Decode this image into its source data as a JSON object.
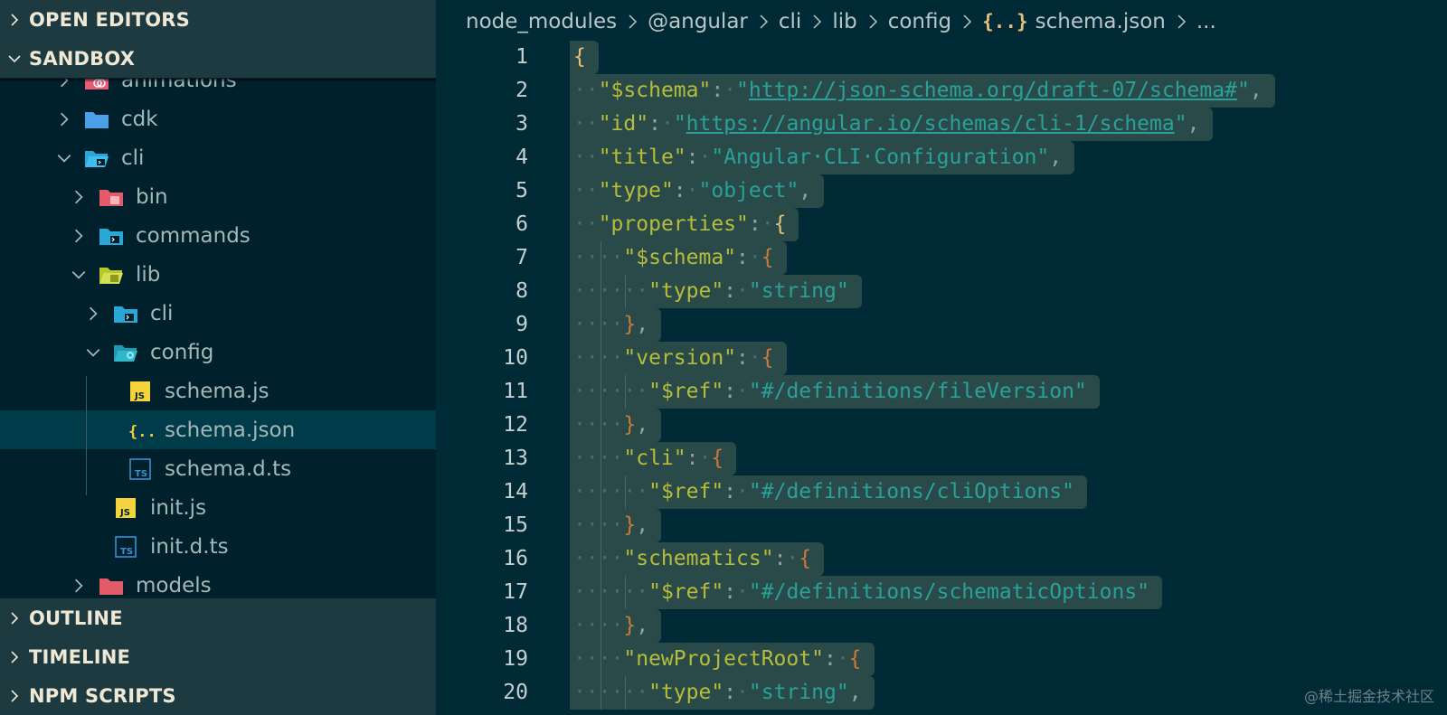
{
  "sidebar": {
    "open_editors": "OPEN EDITORS",
    "sandbox": "SANDBOX",
    "outline": "OUTLINE",
    "timeline": "TIMELINE",
    "npm_scripts": "NPM SCRIPTS",
    "tree": [
      {
        "label": "animations",
        "icon": "folder-animations-icon",
        "state": "collapsed"
      },
      {
        "label": "cdk",
        "icon": "folder-icon",
        "state": "collapsed"
      },
      {
        "label": "cli",
        "icon": "folder-cli-open-icon",
        "state": "expanded"
      },
      {
        "label": "bin",
        "icon": "folder-bin-icon",
        "state": "collapsed"
      },
      {
        "label": "commands",
        "icon": "folder-commands-icon",
        "state": "collapsed"
      },
      {
        "label": "lib",
        "icon": "folder-lib-open-icon",
        "state": "expanded"
      },
      {
        "label": "cli",
        "icon": "folder-cli-icon",
        "state": "collapsed"
      },
      {
        "label": "config",
        "icon": "folder-config-open-icon",
        "state": "expanded"
      },
      {
        "label": "schema.js",
        "icon": "javascript-file-icon",
        "state": "file"
      },
      {
        "label": "schema.json",
        "icon": "json-file-icon",
        "state": "file",
        "selected": true
      },
      {
        "label": "schema.d.ts",
        "icon": "typescript-file-icon",
        "state": "file"
      },
      {
        "label": "init.js",
        "icon": "javascript-file-icon",
        "state": "file"
      },
      {
        "label": "init.d.ts",
        "icon": "typescript-file-icon",
        "state": "file"
      },
      {
        "label": "models",
        "icon": "folder-models-icon",
        "state": "collapsed"
      }
    ]
  },
  "breadcrumb": {
    "parts": [
      "node_modules",
      "@angular",
      "cli",
      "lib",
      "config",
      "schema.json",
      "..."
    ],
    "json_icon": "{..}"
  },
  "editor": {
    "lines": [
      {
        "n": "1",
        "indent": 0,
        "tokens": [
          [
            "t-brace0",
            "{"
          ]
        ]
      },
      {
        "n": "2",
        "indent": 1,
        "tokens": [
          [
            "t-key",
            "\"$schema\""
          ],
          [
            "t-punct",
            ":"
          ],
          [
            "ws",
            "·"
          ],
          [
            "t-str",
            "\""
          ],
          [
            "t-url",
            "http://json-schema.org/draft-07/schema#"
          ],
          [
            "t-str",
            "\""
          ],
          [
            "t-punct",
            ","
          ]
        ]
      },
      {
        "n": "3",
        "indent": 1,
        "tokens": [
          [
            "t-key",
            "\"id\""
          ],
          [
            "t-punct",
            ":"
          ],
          [
            "ws",
            "·"
          ],
          [
            "t-str",
            "\""
          ],
          [
            "t-url",
            "https://angular.io/schemas/cli-1/schema"
          ],
          [
            "t-str",
            "\""
          ],
          [
            "t-punct",
            ","
          ]
        ]
      },
      {
        "n": "4",
        "indent": 1,
        "tokens": [
          [
            "t-key",
            "\"title\""
          ],
          [
            "t-punct",
            ":"
          ],
          [
            "ws",
            "·"
          ],
          [
            "t-str",
            "\"Angular·CLI·Configuration\""
          ],
          [
            "t-punct",
            ","
          ]
        ]
      },
      {
        "n": "5",
        "indent": 1,
        "tokens": [
          [
            "t-key",
            "\"type\""
          ],
          [
            "t-punct",
            ":"
          ],
          [
            "ws",
            "·"
          ],
          [
            "t-str",
            "\"object\""
          ],
          [
            "t-punct",
            ","
          ]
        ]
      },
      {
        "n": "6",
        "indent": 1,
        "tokens": [
          [
            "t-key",
            "\"properties\""
          ],
          [
            "t-punct",
            ":"
          ],
          [
            "ws",
            "·"
          ],
          [
            "t-brace0",
            "{"
          ]
        ]
      },
      {
        "n": "7",
        "indent": 2,
        "tokens": [
          [
            "t-key",
            "\"$schema\""
          ],
          [
            "t-punct",
            ":"
          ],
          [
            "ws",
            "·"
          ],
          [
            "t-brace1",
            "{"
          ]
        ]
      },
      {
        "n": "8",
        "indent": 3,
        "tokens": [
          [
            "t-key",
            "\"type\""
          ],
          [
            "t-punct",
            ":"
          ],
          [
            "ws",
            "·"
          ],
          [
            "t-str",
            "\"string\""
          ]
        ]
      },
      {
        "n": "9",
        "indent": 2,
        "tokens": [
          [
            "t-brace1",
            "}"
          ],
          [
            "t-punct",
            ","
          ]
        ]
      },
      {
        "n": "10",
        "indent": 2,
        "tokens": [
          [
            "t-key",
            "\"version\""
          ],
          [
            "t-punct",
            ":"
          ],
          [
            "ws",
            "·"
          ],
          [
            "t-brace1",
            "{"
          ]
        ]
      },
      {
        "n": "11",
        "indent": 3,
        "tokens": [
          [
            "t-key",
            "\"$ref\""
          ],
          [
            "t-punct",
            ":"
          ],
          [
            "ws",
            "·"
          ],
          [
            "t-str",
            "\"#/definitions/fileVersion\""
          ]
        ]
      },
      {
        "n": "12",
        "indent": 2,
        "tokens": [
          [
            "t-brace1",
            "}"
          ],
          [
            "t-punct",
            ","
          ]
        ]
      },
      {
        "n": "13",
        "indent": 2,
        "tokens": [
          [
            "t-key",
            "\"cli\""
          ],
          [
            "t-punct",
            ":"
          ],
          [
            "ws",
            "·"
          ],
          [
            "t-brace1",
            "{"
          ]
        ]
      },
      {
        "n": "14",
        "indent": 3,
        "tokens": [
          [
            "t-key",
            "\"$ref\""
          ],
          [
            "t-punct",
            ":"
          ],
          [
            "ws",
            "·"
          ],
          [
            "t-str",
            "\"#/definitions/cliOptions\""
          ]
        ]
      },
      {
        "n": "15",
        "indent": 2,
        "tokens": [
          [
            "t-brace1",
            "}"
          ],
          [
            "t-punct",
            ","
          ]
        ]
      },
      {
        "n": "16",
        "indent": 2,
        "tokens": [
          [
            "t-key",
            "\"schematics\""
          ],
          [
            "t-punct",
            ":"
          ],
          [
            "ws",
            "·"
          ],
          [
            "t-brace1",
            "{"
          ]
        ]
      },
      {
        "n": "17",
        "indent": 3,
        "tokens": [
          [
            "t-key",
            "\"$ref\""
          ],
          [
            "t-punct",
            ":"
          ],
          [
            "ws",
            "·"
          ],
          [
            "t-str",
            "\"#/definitions/schematicOptions\""
          ]
        ]
      },
      {
        "n": "18",
        "indent": 2,
        "tokens": [
          [
            "t-brace1",
            "}"
          ],
          [
            "t-punct",
            ","
          ]
        ]
      },
      {
        "n": "19",
        "indent": 2,
        "tokens": [
          [
            "t-key",
            "\"newProjectRoot\""
          ],
          [
            "t-punct",
            ":"
          ],
          [
            "ws",
            "·"
          ],
          [
            "t-brace1",
            "{"
          ]
        ]
      },
      {
        "n": "20",
        "indent": 3,
        "tokens": [
          [
            "t-key",
            "\"type\""
          ],
          [
            "t-punct",
            ":"
          ],
          [
            "ws",
            "·"
          ],
          [
            "t-str",
            "\"string\""
          ],
          [
            "t-punct",
            ","
          ]
        ]
      }
    ]
  },
  "watermark": "@稀土掘金技术社区",
  "colors": {
    "editor_bg": "#002b36",
    "sidebar_bg": "#00212b",
    "key": "#b5bd3a",
    "string": "#2aa198",
    "brace": "#e5c07b",
    "brace_nested": "#cb7a3a",
    "line_highlight": "#2a4a4a"
  }
}
